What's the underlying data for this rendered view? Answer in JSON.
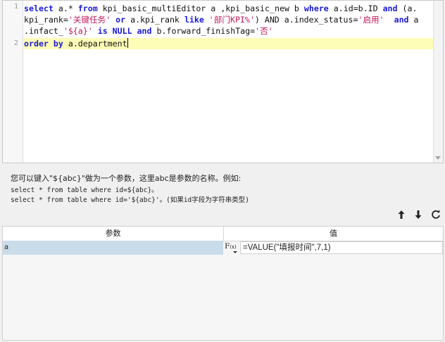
{
  "editor": {
    "line_numbers": [
      "1",
      "2"
    ],
    "line1_row1": [
      {
        "t": "select",
        "c": "kw"
      },
      {
        "t": " a.* ",
        "c": ""
      },
      {
        "t": "from",
        "c": "kw"
      },
      {
        "t": " kpi_basic_multiEditor a ,kpi_basic_new b ",
        "c": ""
      },
      {
        "t": "where",
        "c": "kw"
      },
      {
        "t": " a.id=b.ID ",
        "c": ""
      },
      {
        "t": "and",
        "c": "kw"
      },
      {
        "t": " (a.",
        "c": ""
      }
    ],
    "line1_row2": [
      {
        "t": "kpi_rank=",
        "c": ""
      },
      {
        "t": "'关键任务'",
        "c": "str"
      },
      {
        "t": " ",
        "c": ""
      },
      {
        "t": "or",
        "c": "kw"
      },
      {
        "t": " a.kpi_rank ",
        "c": ""
      },
      {
        "t": "like",
        "c": "kw"
      },
      {
        "t": " ",
        "c": ""
      },
      {
        "t": "'部门KPI%'",
        "c": "str"
      },
      {
        "t": ") AND a.index_status=",
        "c": ""
      },
      {
        "t": "'启用'",
        "c": "str"
      },
      {
        "t": "  ",
        "c": ""
      },
      {
        "t": "and",
        "c": "kw"
      },
      {
        "t": " a",
        "c": ""
      }
    ],
    "line1_row3": [
      {
        "t": ".infact_",
        "c": ""
      },
      {
        "t": "'${a}'",
        "c": "str"
      },
      {
        "t": " ",
        "c": ""
      },
      {
        "t": "is",
        "c": "kw"
      },
      {
        "t": " ",
        "c": ""
      },
      {
        "t": "NULL",
        "c": "kw"
      },
      {
        "t": " ",
        "c": ""
      },
      {
        "t": "and",
        "c": "kw"
      },
      {
        "t": " b.forward_finishTag=",
        "c": ""
      },
      {
        "t": "'否'",
        "c": "str"
      }
    ],
    "line2": [
      {
        "t": "order",
        "c": "kw"
      },
      {
        "t": " ",
        "c": ""
      },
      {
        "t": "by",
        "c": "kw"
      },
      {
        "t": " a.department",
        "c": ""
      }
    ]
  },
  "hint": {
    "line1": "您可以键入\"${abc}\"做为一个参数，这里abc是参数的名称。例如:",
    "line2": "select * from table where id=${abc}。",
    "line3": "select * from table where id='${abc}'。(如果id字段为字符串类型)"
  },
  "toolbar": {
    "move_up": "move-up-arrow-icon",
    "move_down": "move-down-arrow-icon",
    "refresh": "refresh-icon"
  },
  "grid": {
    "headers": [
      "参数",
      "值"
    ],
    "rows": [
      {
        "name": "a",
        "fx_label": "F",
        "fx_sub": "(x)",
        "value": "=VALUE(\"填报时间\",7,1)"
      }
    ]
  },
  "colors": {
    "keyword": "#1919d6",
    "string": "#c2185b",
    "active_line": "#fefdb7",
    "selected_row": "#c9dcea"
  }
}
